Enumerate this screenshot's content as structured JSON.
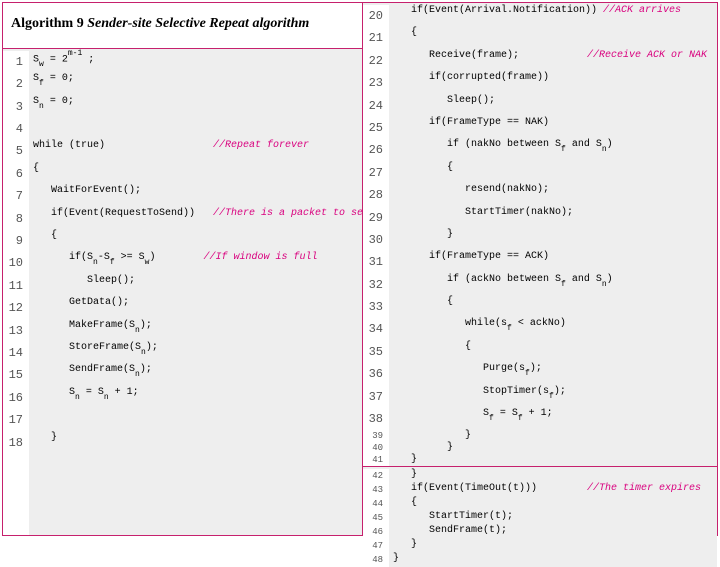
{
  "title": {
    "label": "Algorithm 9",
    "desc": "Sender-site Selective Repeat algorithm"
  },
  "left": {
    "l1": {
      "code": "S",
      "sub1": "w",
      "rest": " = 2",
      "sup": "m-1",
      "tail": " ;"
    },
    "l2": {
      "code": "S",
      "sub1": "f",
      "rest": " = 0;"
    },
    "l3": {
      "code": "S",
      "sub1": "n",
      "rest": " = 0;"
    },
    "l4": {
      "code": ""
    },
    "l5": {
      "code": "while (true)",
      "comment": "//Repeat forever"
    },
    "l6": {
      "code": "{"
    },
    "l7": {
      "code": "   WaitForEvent();"
    },
    "l8": {
      "code": "   if(Event(RequestToSend))",
      "comment": "//There is a packet to send"
    },
    "l9": {
      "code": "   {"
    },
    "l10": {
      "pre": "      if(S",
      "sub1": "n",
      "mid": "-S",
      "sub2": "f",
      "post": " >= S",
      "sub3": "w",
      "end": ")",
      "comment": "//If window is full"
    },
    "l11": {
      "code": "         Sleep();"
    },
    "l12": {
      "code": "      GetData();"
    },
    "l13": {
      "pre": "      MakeFrame(S",
      "sub1": "n",
      "end": ");"
    },
    "l14": {
      "pre": "      StoreFrame(S",
      "sub1": "n",
      "end": ");"
    },
    "l15": {
      "pre": "      SendFrame(S",
      "sub1": "n",
      "end": ");"
    },
    "l16": {
      "pre": "      S",
      "sub1": "n",
      "mid": " = S",
      "sub2": "n",
      "end": " + 1;"
    },
    "l17": {
      "code": " "
    },
    "l18": {
      "code": "   }"
    }
  },
  "right": {
    "l20": {
      "code": "   if(Event(Arrival.Notification))",
      "comment": "//ACK arrives"
    },
    "l21": {
      "code": "   {"
    },
    "l22": {
      "code": "      Receive(frame);",
      "comment": "//Receive ACK or NAK"
    },
    "l23": {
      "code": "      if(corrupted(frame))"
    },
    "l24": {
      "code": "         Sleep();"
    },
    "l25": {
      "code": "      if(FrameType == NAK)"
    },
    "l26": {
      "pre": "         if (nakNo between S",
      "sub1": "f",
      "mid": " and S",
      "sub2": "n",
      "end": ")"
    },
    "l27": {
      "code": "         {"
    },
    "l28": {
      "code": "            resend(nakNo);"
    },
    "l29": {
      "code": "            StartTimer(nakNo);"
    },
    "l30": {
      "code": "         }"
    },
    "l31": {
      "code": "      if(FrameType == ACK)"
    },
    "l32": {
      "pre": "         if (ackNo between S",
      "sub1": "f",
      "mid": " and S",
      "sub2": "n",
      "end": ")"
    },
    "l33": {
      "code": "         {"
    },
    "l34": {
      "pre": "            while(s",
      "sub1": "f",
      "end": " < ackNo)"
    },
    "l35": {
      "code": "            {"
    },
    "l36": {
      "pre": "               Purge(s",
      "sub1": "f",
      "end": ");"
    },
    "l37": {
      "pre": "               StopTimer(s",
      "sub1": "f",
      "end": ");"
    },
    "l38": {
      "pre": "               S",
      "sub1": "f",
      "mid": " = S",
      "sub2": "f",
      "end": " + 1;"
    },
    "l39": {
      "code": "            }"
    },
    "l40": {
      "code": "         }"
    },
    "l41": {
      "code": "   }"
    },
    "l42": {
      "code": "   }"
    },
    "l43": {
      "code": "   if(Event(TimeOut(t)))",
      "comment": "//The timer expires"
    },
    "l44": {
      "code": "   {"
    },
    "l45": {
      "code": "      StartTimer(t);"
    },
    "l46": {
      "code": "      SendFrame(t);"
    },
    "l47": {
      "code": "   }"
    },
    "l48": {
      "code": "}"
    }
  },
  "nums": {
    "left": [
      "1",
      "2",
      "3",
      "4",
      "5",
      "6",
      "7",
      "8",
      "9",
      "10",
      "11",
      "12",
      "13",
      "14",
      "15",
      "16",
      "17",
      "18"
    ],
    "right_top": [
      "20",
      "21",
      "22",
      "23",
      "24",
      "25",
      "26",
      "27",
      "28",
      "29",
      "30",
      "31",
      "32",
      "33",
      "34",
      "35",
      "36",
      "37",
      "38",
      "39",
      "40",
      "41"
    ],
    "right_bot": [
      "42",
      "43",
      "44",
      "45",
      "46",
      "47",
      "48"
    ]
  }
}
